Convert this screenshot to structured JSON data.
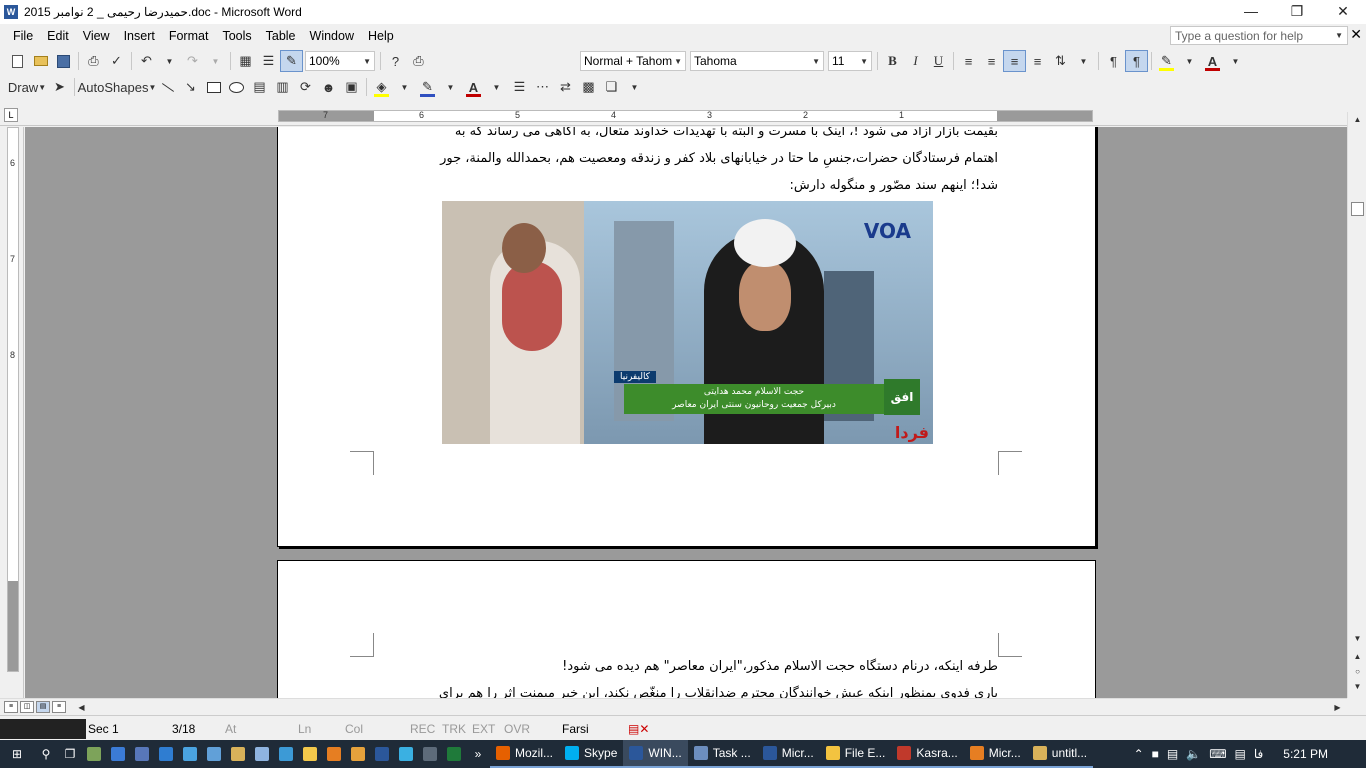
{
  "window": {
    "title": "حمیدرضا رحیمی _ 2 نوامبر 2015.doc - Microsoft Word",
    "app_icon": "W"
  },
  "menu": [
    "File",
    "Edit",
    "View",
    "Insert",
    "Format",
    "Tools",
    "Table",
    "Window",
    "Help"
  ],
  "help_box": {
    "placeholder": "Type a question for help"
  },
  "toolbar": {
    "zoom": "100%",
    "style": "Normal + Tahom",
    "font": "Tahoma",
    "size": "11",
    "bold": "B",
    "italic": "I",
    "underline": "U",
    "highlight_color": "#ffff00",
    "font_color": "#c00000"
  },
  "drawing": {
    "draw_label": "Draw",
    "autoshapes_label": "AutoShapes"
  },
  "ruler": {
    "numbers": [
      "7",
      "6",
      "5",
      "4",
      "3",
      "2",
      "1"
    ]
  },
  "vruler": {
    "numbers": [
      "6",
      "7",
      "8"
    ]
  },
  "document": {
    "para1_line1": "بقیمت بازار آزاد می شود !، اینک با مسرت و البته با تهدیدات خداوند متعال، به آگاهی می رساند که به",
    "para1_line2": "اهتمام فرستادگان حضرات،جنسِ ما حتا در خیابانهای بلاد کفر و زندقه ومعصیت هم، بحمدالله والمنة، جور",
    "para1_line3": "شد!؛ اینهم سند مصّور و منگوله دارش:",
    "image": {
      "logo": "VOA",
      "location": "کالیفرنیا",
      "caption_name": "حجت الاسلام محمد هدایتی",
      "caption_title": "دبیرکل جمعیت روحانیون سنتی ایران معاصر",
      "badge": "افق",
      "watermark": "فردا"
    },
    "para2_line1": "طرفه اینکه، درنام دستگاه حجت الاسلام مذکور،\"ایران معاصر\" هم دیده می شود!",
    "para2_line2": "باری فدوی بمنظور اینکه عیش خوانندگان محترم ضدانقلاب را منغّص نکند، این خبر میمنت اثر را هم برای"
  },
  "status": {
    "section": "Sec 1",
    "pages": "3/18",
    "at": "At",
    "ln": "Ln",
    "col": "Col",
    "rec": "REC",
    "trk": "TRK",
    "ext": "EXT",
    "ovr": "OVR",
    "language": "Farsi"
  },
  "taskbar": {
    "tabs": [
      {
        "label": "Mozil...",
        "color": "#e66000"
      },
      {
        "label": "Skype",
        "color": "#00aff0"
      },
      {
        "label": "WIN...",
        "color": "#2b579a"
      },
      {
        "label": "Task ...",
        "color": "#6c8ebf"
      },
      {
        "label": "Micr...",
        "color": "#2b579a"
      },
      {
        "label": "File E...",
        "color": "#f3c340"
      },
      {
        "label": "Kasra...",
        "color": "#c0392b"
      },
      {
        "label": "Micr...",
        "color": "#e67e22"
      },
      {
        "label": "untitl...",
        "color": "#d8b25a"
      }
    ],
    "lang": "فا",
    "time": "5:21 PM",
    "quick_launch_overflow": "»"
  }
}
